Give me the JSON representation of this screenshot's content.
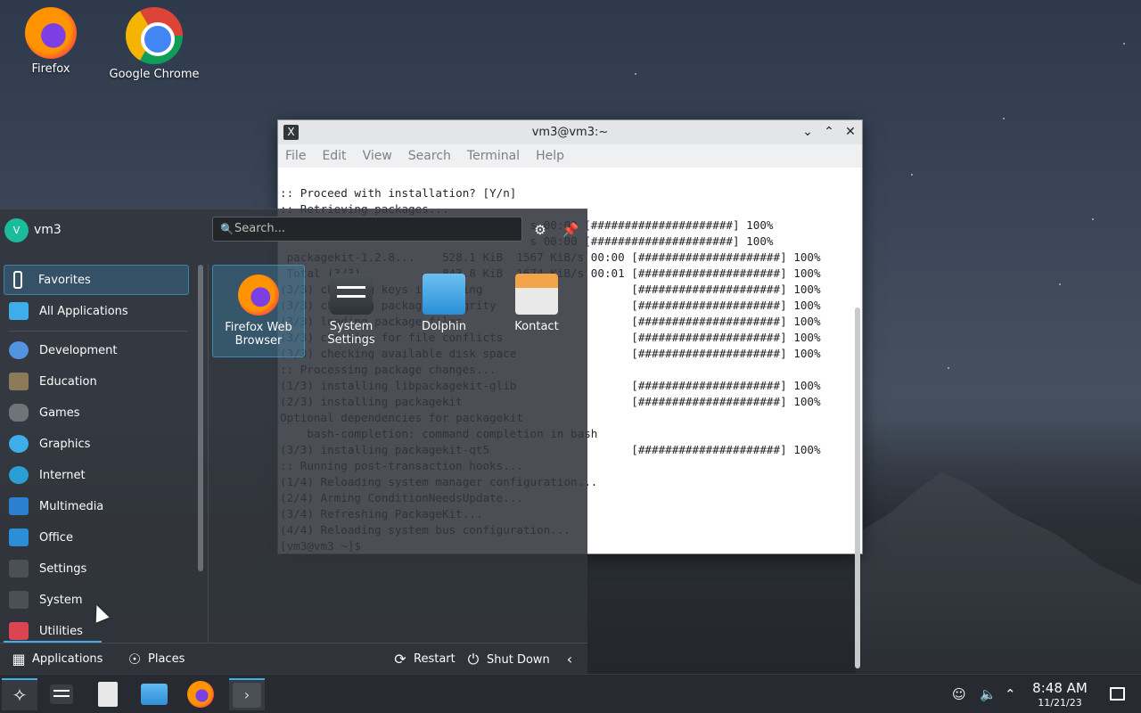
{
  "desktop": {
    "icons": [
      {
        "label": "Firefox",
        "icon": "firefox-icon"
      },
      {
        "label": "Google Chrome",
        "icon": "chrome-icon"
      }
    ]
  },
  "terminal": {
    "title": "vm3@vm3:~",
    "menu": [
      "File",
      "Edit",
      "View",
      "Search",
      "Terminal",
      "Help"
    ],
    "lines": [
      ":: Proceed with installation? [Y/n]",
      ":: Retrieving packages...",
      "                                     s 00:00 [#####################] 100%",
      "                                     s 00:00 [#####################] 100%",
      " packagekit-1.2.8...    528.1 KiB  1567 KiB/s 00:00 [#####################] 100%",
      " Total (3/3)            843.8 KiB  1674 KiB/s 00:01 [#####################] 100%",
      "(3/3) checking keys in keyring                      [#####################] 100%",
      "(3/3) checking package integrity                    [#####################] 100%",
      "(3/3) loading package files                         [#####################] 100%",
      "(3/3) checking for file conflicts                   [#####################] 100%",
      "(3/3) checking available disk space                 [#####################] 100%",
      ":: Processing package changes...",
      "(1/3) installing libpackagekit-glib                 [#####################] 100%",
      "(2/3) installing packagekit                         [#####################] 100%",
      "Optional dependencies for packagekit",
      "    bash-completion: command completion in bash",
      "(3/3) installing packagekit-qt5                     [#####################] 100%",
      ":: Running post-transaction hooks...",
      "(1/4) Reloading system manager configuration...",
      "(2/4) Arming ConditionNeedsUpdate...",
      "(3/4) Refreshing PackageKit...",
      "(4/4) Reloading system bus configuration...",
      "[vm3@vm3 ~]$ "
    ]
  },
  "launcher": {
    "user": {
      "initial": "V",
      "name": "vm3"
    },
    "search_placeholder": "Search...",
    "categories": [
      {
        "label": "Favorites",
        "color": "#2e3338",
        "selected": true
      },
      {
        "label": "All Applications",
        "color": "#3daee9"
      },
      {
        "label": "Development",
        "color": "#5294e2"
      },
      {
        "label": "Education",
        "color": "#8a7a5a"
      },
      {
        "label": "Games",
        "color": "#6f7479"
      },
      {
        "label": "Graphics",
        "color": "#3daee9"
      },
      {
        "label": "Internet",
        "color": "#2a9fd6"
      },
      {
        "label": "Multimedia",
        "color": "#2d7fd0"
      },
      {
        "label": "Office",
        "color": "#2a8fd8"
      },
      {
        "label": "Settings",
        "color": "#4a5056"
      },
      {
        "label": "System",
        "color": "#4a5056"
      },
      {
        "label": "Utilities",
        "color": "#da4453"
      }
    ],
    "favorites": [
      {
        "label_line1": "Firefox Web",
        "label_line2": "Browser",
        "icon": "firefox-icon"
      },
      {
        "label_line1": "System",
        "label_line2": "Settings",
        "icon": "system-settings-icon"
      },
      {
        "label_line1": "Dolphin",
        "label_line2": "",
        "icon": "dolphin-icon"
      },
      {
        "label_line1": "Kontact",
        "label_line2": "",
        "icon": "kontact-icon"
      }
    ],
    "footer": {
      "applications": "Applications",
      "places": "Places",
      "restart": "Restart",
      "shutdown": "Shut Down"
    }
  },
  "taskbar": {
    "clock_time": "8:48 AM",
    "clock_date": "11/21/23"
  }
}
